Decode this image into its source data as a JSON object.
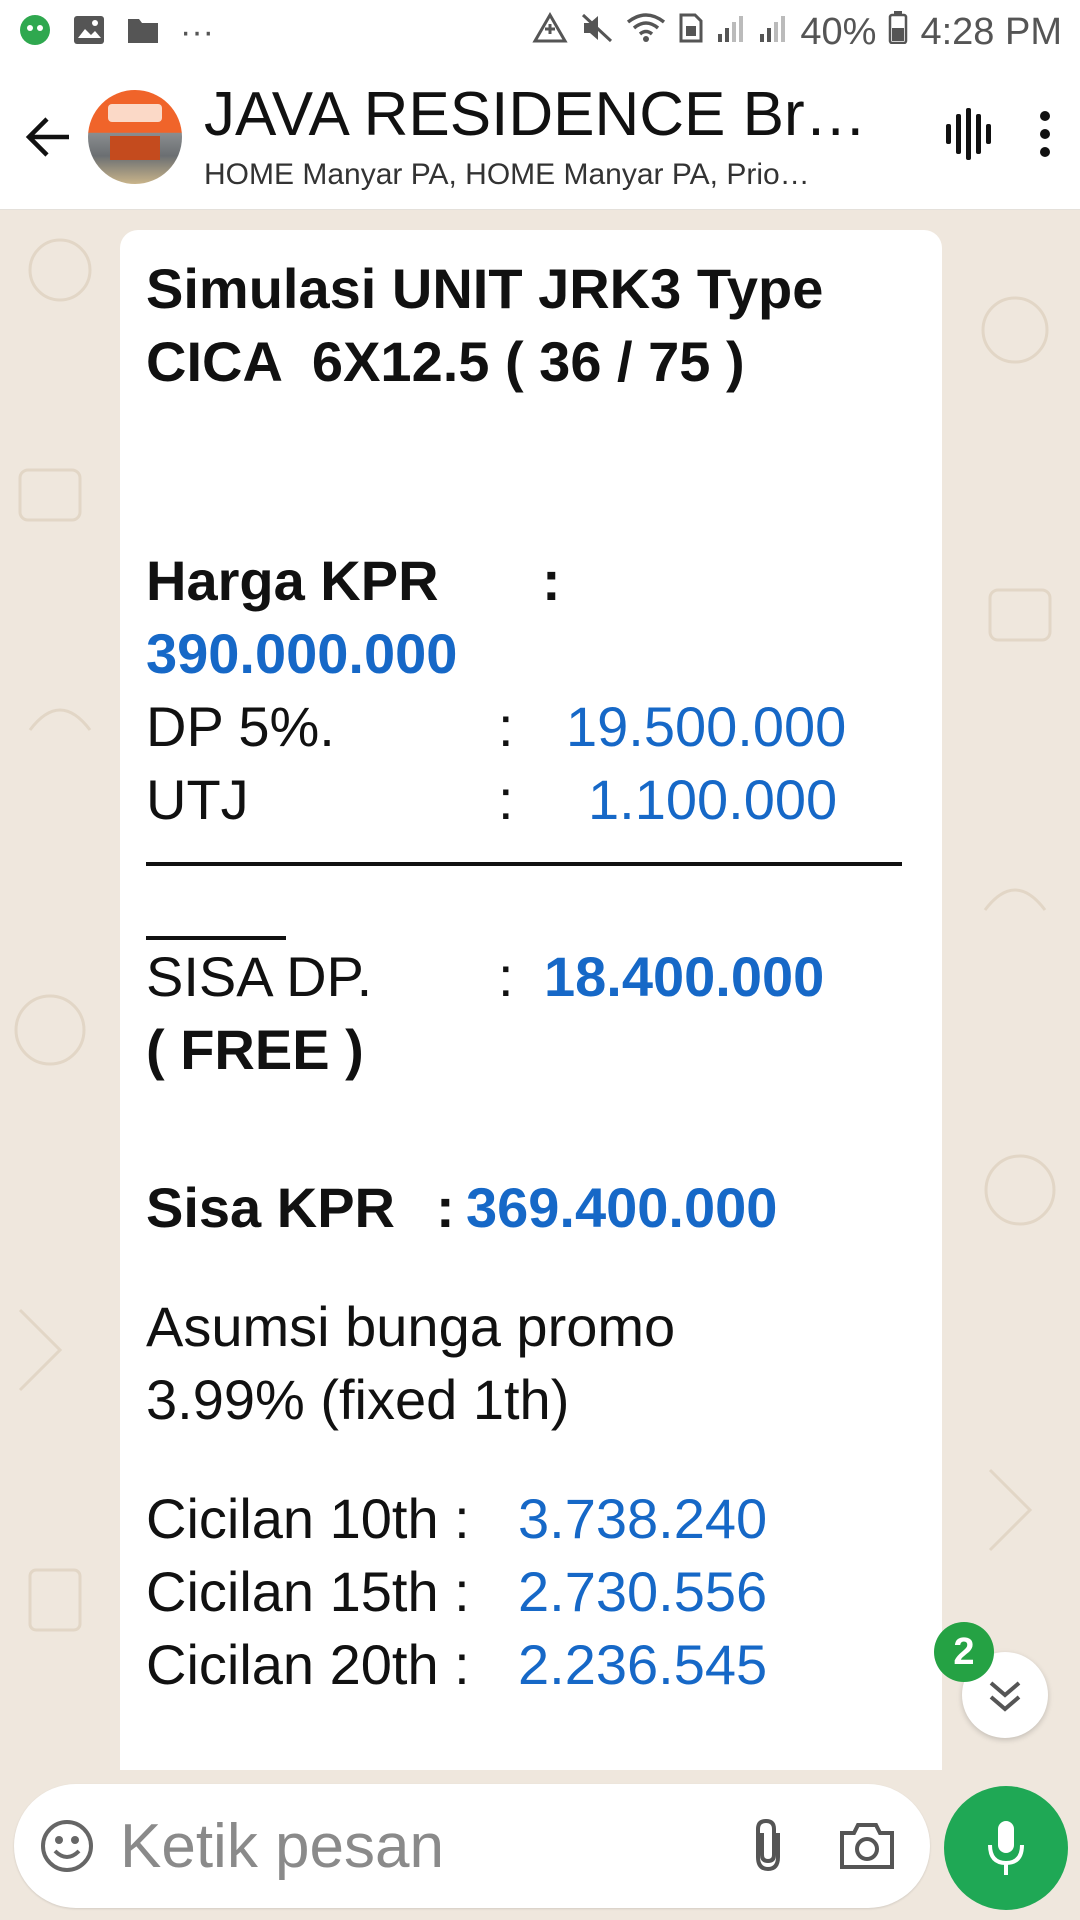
{
  "status_bar": {
    "battery": "40%",
    "time": "4:28 PM",
    "more": "···"
  },
  "header": {
    "title": "JAVA RESIDENCE Br…",
    "subtitle": "HOME Manyar PA, HOME Manyar PA, Prio…"
  },
  "message": {
    "heading_line1": "Simulasi UNIT JRK3 Type",
    "heading_line2": "CICA  6X12.5 ( 36 / 75 )",
    "harga_label": "Harga KPR",
    "harga_colon": ":",
    "harga_value": "390.000.000",
    "dp_label": "DP 5%.",
    "dp_colon": ":",
    "dp_value": "19.500.000",
    "utj_label": "UTJ",
    "utj_colon": ":",
    "utj_value": "1.100.000",
    "sisa_dp_label": "SISA DP.",
    "sisa_dp_colon": ":",
    "sisa_dp_value": "18.400.000",
    "free_label": "( FREE )",
    "sisa_kpr_label": "Sisa KPR",
    "sisa_kpr_colon": ":",
    "sisa_kpr_value": "369.400.000",
    "bunga_line1": "Asumsi bunga promo",
    "bunga_line2": "3.99% (fixed 1th)",
    "cicilan": [
      {
        "label": "Cicilan 10th :",
        "value": "3.738.240"
      },
      {
        "label": "Cicilan 15th :",
        "value": "2.730.556"
      },
      {
        "label": "Cicilan 20th :",
        "value": "2.236.545"
      }
    ]
  },
  "unread_count": "2",
  "composer": {
    "placeholder": "Ketik pesan"
  },
  "colors": {
    "accent_green": "#1fa855",
    "value_blue": "#1668c7",
    "chat_bg": "#efe7dd"
  }
}
